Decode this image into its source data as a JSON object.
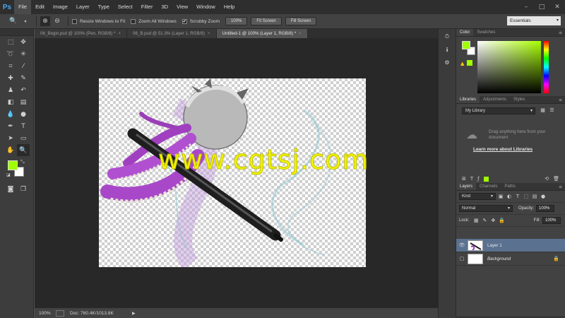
{
  "app": {
    "logo": "Ps"
  },
  "menu": [
    "File",
    "Edit",
    "Image",
    "Layer",
    "Type",
    "Select",
    "Filter",
    "3D",
    "View",
    "Window",
    "Help"
  ],
  "window_controls": {
    "minimize": "–",
    "maximize": "□",
    "close": "✕"
  },
  "options_bar": {
    "resize_windows_label": "Resize Windows to Fit",
    "zoom_all_label": "Zoom All Windows",
    "scrubby_zoom_label": "Scrubby Zoom",
    "scrubby_checked": "✔",
    "btn_100": "100%",
    "btn_fit": "Fit Screen",
    "btn_fill": "Fill Screen",
    "workspace": "Essentials"
  },
  "doc_tabs": [
    {
      "label": "06_Begin.psd @ 100% (Pen, RGB/8) *",
      "close": "×"
    },
    {
      "label": "06_B.psd @ 51.3% (Layer 1, RGB/8)",
      "close": "×"
    },
    {
      "label": "Untitled-1 @ 100% (Layer 1, RGB/8) *",
      "close": "×"
    }
  ],
  "watermark": "www.cgtsj.com",
  "status": {
    "zoom": "100%",
    "doc": "Doc: 760.4K/1013.8K",
    "arrow": "▶"
  },
  "colors": {
    "foreground": "#a0ff00",
    "background": "#ffffff",
    "selection": "#5a7190"
  },
  "color_panel": {
    "tabs": [
      "Color",
      "Swatches"
    ]
  },
  "libraries_panel": {
    "tabs": [
      "Libraries",
      "Adjustments",
      "Styles"
    ],
    "library": "My Library",
    "drag_text": "Drag anything here from your document",
    "learn_link": "Learn more about Libraries"
  },
  "layers_panel": {
    "tabs": [
      "Layers",
      "Channels",
      "Paths"
    ],
    "filter": "Kind",
    "blend_mode": "Normal",
    "opacity_label": "Opacity:",
    "opacity_value": "100%",
    "lock_label": "Lock:",
    "fill_label": "Fill:",
    "fill_value": "100%",
    "layers": [
      {
        "name": "Layer 1"
      },
      {
        "name": "Background"
      }
    ]
  }
}
